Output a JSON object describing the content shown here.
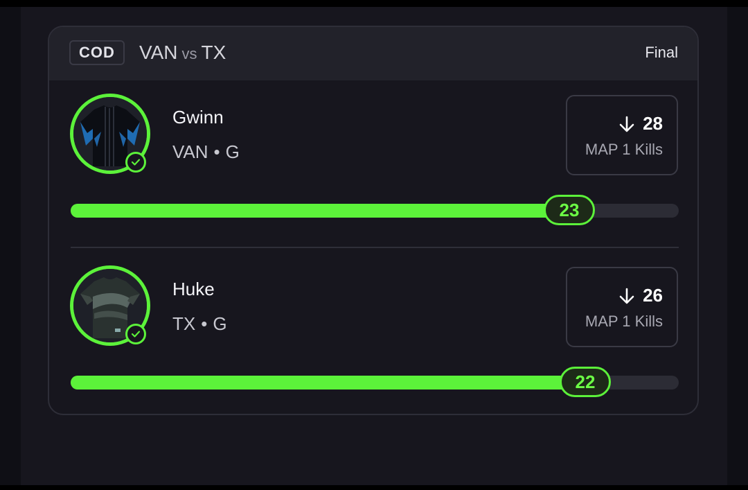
{
  "header": {
    "game": "COD",
    "team_home": "VAN",
    "vs": "vs",
    "team_away": "TX",
    "status": "Final"
  },
  "players": [
    {
      "name": "Gwinn",
      "team": "VAN",
      "dot": "•",
      "position": "G",
      "line": "28",
      "direction": "down",
      "stat_label": "MAP 1 Kills",
      "actual": "23",
      "progress_fraction": 0.82,
      "jersey_colors": [
        "#0c0e14",
        "#1f7fd6"
      ],
      "verified": true
    },
    {
      "name": "Huke",
      "team": "TX",
      "dot": "•",
      "position": "G",
      "line": "26",
      "direction": "down",
      "stat_label": "MAP 1 Kills",
      "actual": "22",
      "progress_fraction": 0.846,
      "jersey_colors": [
        "#2a3230",
        "#6d7d78"
      ],
      "verified": true
    }
  ],
  "colors": {
    "accent": "#5cf23a",
    "background": "#17161e",
    "header": "#22222a"
  }
}
